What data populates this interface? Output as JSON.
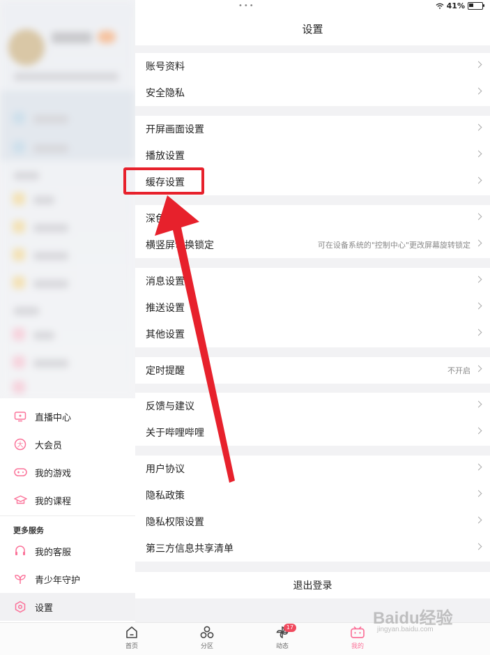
{
  "status_bar": {
    "dots": "•••",
    "battery": "41%"
  },
  "nav": {
    "title": "设置"
  },
  "sidebar": {
    "items": [
      {
        "label": "直播中心",
        "icon": "tv-icon"
      },
      {
        "label": "大会员",
        "icon": "vip-icon"
      },
      {
        "label": "我的游戏",
        "icon": "gamepad-icon"
      },
      {
        "label": "我的课程",
        "icon": "graduation-cap-icon"
      }
    ],
    "section_title": "更多服务",
    "more_items": [
      {
        "label": "我的客服",
        "icon": "headset-icon"
      },
      {
        "label": "青少年守护",
        "icon": "sprout-icon"
      },
      {
        "label": "设置",
        "icon": "settings-hexagon-icon"
      }
    ]
  },
  "settings": {
    "groups": [
      [
        {
          "label": "账号资料"
        },
        {
          "label": "安全隐私"
        }
      ],
      [
        {
          "label": "开屏画面设置"
        },
        {
          "label": "播放设置"
        },
        {
          "label": "缓存设置"
        }
      ],
      [
        {
          "label": "深色模式"
        },
        {
          "label": "横竖屏切换锁定",
          "value": "可在设备系统的\"控制中心\"更改屏幕旋转锁定"
        }
      ],
      [
        {
          "label": "消息设置"
        },
        {
          "label": "推送设置"
        },
        {
          "label": "其他设置"
        }
      ],
      [
        {
          "label": "定时提醒",
          "value": "不开启"
        }
      ],
      [
        {
          "label": "反馈与建议"
        },
        {
          "label": "关于哔哩哔哩"
        }
      ],
      [
        {
          "label": "用户协议"
        },
        {
          "label": "隐私政策"
        },
        {
          "label": "隐私权限设置"
        },
        {
          "label": "第三方信息共享清单"
        }
      ]
    ],
    "logout": "退出登录"
  },
  "tabbar": {
    "tabs": [
      {
        "label": "首页",
        "icon": "home-icon"
      },
      {
        "label": "分区",
        "icon": "category-icon"
      },
      {
        "label": "动态",
        "icon": "pinwheel-icon",
        "badge": "17"
      },
      {
        "label": "我的",
        "icon": "bilibili-tv-icon",
        "active": true
      }
    ]
  },
  "watermark": {
    "brand": "Baidu经验",
    "url": "jingyan.baidu.com"
  },
  "colors": {
    "accent": "#fb7299",
    "annotation": "#e7212c"
  }
}
